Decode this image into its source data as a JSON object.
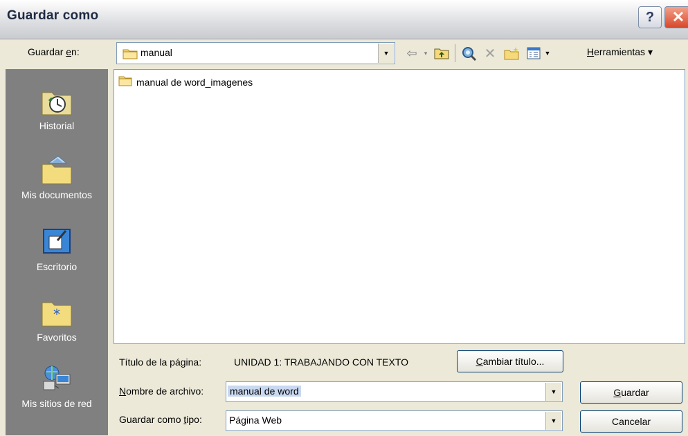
{
  "window": {
    "title": "Guardar como",
    "help": "?",
    "close": "✕"
  },
  "toolbar": {
    "save_in_label_pre": "Guardar ",
    "save_in_label_u": "e",
    "save_in_label_post": "n:",
    "current_folder": "manual",
    "tools_menu_u": "H",
    "tools_menu_rest": "erramientas",
    "tools_menu_arrow": "▾"
  },
  "places": [
    {
      "label": "Historial",
      "icon": "history-icon"
    },
    {
      "label": "Mis documentos",
      "icon": "my-documents-icon"
    },
    {
      "label": "Escritorio",
      "icon": "desktop-icon"
    },
    {
      "label": "Favoritos",
      "icon": "favorites-icon"
    },
    {
      "label": "Mis sitios de red",
      "icon": "network-places-icon"
    }
  ],
  "files": [
    {
      "name": "manual de word_imagenes",
      "icon": "folder-icon"
    }
  ],
  "page_title": {
    "label": "Título de la página:",
    "value": "UNIDAD 1: TRABAJANDO CON TEXTO",
    "button_u": "C",
    "button_rest": "ambiar título..."
  },
  "filename": {
    "label_u": "N",
    "label_rest": "ombre de archivo:",
    "value": "manual de word"
  },
  "filetype": {
    "label_pre": "Guardar como ",
    "label_u": "t",
    "label_post": "ipo:",
    "value": "Página Web"
  },
  "buttons": {
    "save_u": "G",
    "save_rest": "uardar",
    "cancel": "Cancelar"
  }
}
